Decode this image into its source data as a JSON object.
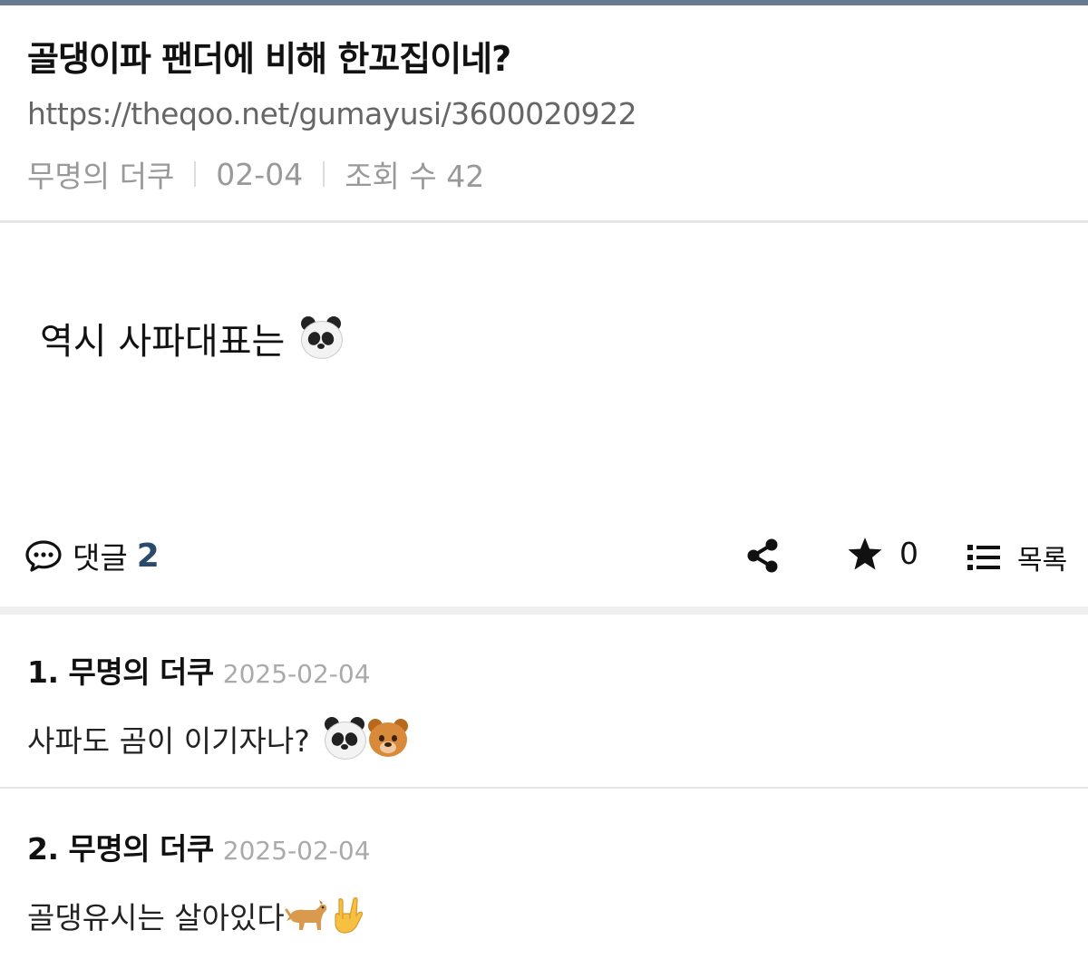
{
  "post": {
    "title": "골댕이파 팬더에 비해 한꼬집이네?",
    "url": "https://theqoo.net/gumayusi/3600020922",
    "author": "무명의 더쿠",
    "date": "02-04",
    "views_label": "조회 수 42",
    "body": "역시 사파대표는"
  },
  "actions": {
    "comments_label": "댓글",
    "comments_count": "2",
    "star_count": "0",
    "list_label": "목록"
  },
  "comments": [
    {
      "author": "1. 무명의 더쿠",
      "date": "2025-02-04",
      "text": "사파도 곰이 이기자나?",
      "emojis": [
        "panda-emoji",
        "bear-emoji"
      ]
    },
    {
      "author": "2. 무명의 더쿠",
      "date": "2025-02-04",
      "text": "골댕유시는 살아있다",
      "emojis": [
        "dog-emoji",
        "rock-hand-emoji"
      ]
    }
  ],
  "colors": {
    "topbar": "#6b7a93",
    "comment_count": "#2b4a6b"
  }
}
